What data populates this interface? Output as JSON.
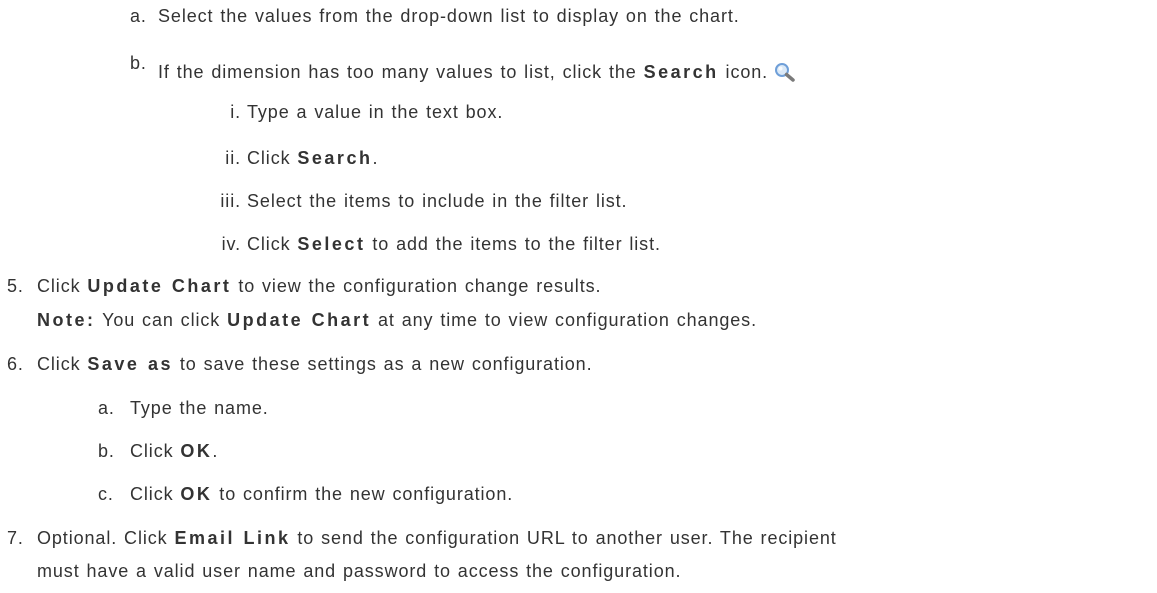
{
  "steps": {
    "a": {
      "marker": "a.",
      "text": "Select the values from the drop-down list to display on the chart."
    },
    "b": {
      "marker": "b.",
      "text_before": "If the dimension has too many values to list, click the ",
      "bold": "Search",
      "text_after": " icon.",
      "icon": "search-magnifier-icon"
    },
    "sub": [
      {
        "marker": "i.",
        "text": "Type a value in the text box."
      },
      {
        "marker": "ii.",
        "text_before": "Click ",
        "bold": "Search",
        "text_after": "."
      },
      {
        "marker": "iii.",
        "text": "Select the items to include in the filter list."
      },
      {
        "marker": "iv.",
        "text_before": "Click ",
        "bold": "Select",
        "text_after": " to add the items to the filter list."
      }
    ],
    "step5": {
      "marker": "5.",
      "text_before": "Click ",
      "bold": "Update Chart",
      "text_after": " to view the configuration change results.",
      "note_label": "Note:",
      "note_before": " You can click ",
      "note_bold": "Update Chart",
      "note_after": " at any time to view configuration changes."
    },
    "step6": {
      "marker": "6.",
      "text_before": "Click ",
      "bold": "Save as",
      "text_after": " to save these settings as a new configuration.",
      "sub": [
        {
          "marker": "a.",
          "text": "Type the name."
        },
        {
          "marker": "b.",
          "text_before": "Click ",
          "bold": "OK",
          "text_after": "."
        },
        {
          "marker": "c.",
          "text_before": "Click ",
          "bold": "OK",
          "text_after": " to confirm the new configuration."
        }
      ]
    },
    "step7": {
      "marker": "7.",
      "text_before": "Optional. Click ",
      "bold": "Email Link",
      "text_after": " to send the configuration URL to another user. The recipient",
      "line2": "must have a valid user name and password to access the configuration."
    }
  },
  "colors": {
    "text": "#333333",
    "icon_lens": "#6f9fd8"
  }
}
